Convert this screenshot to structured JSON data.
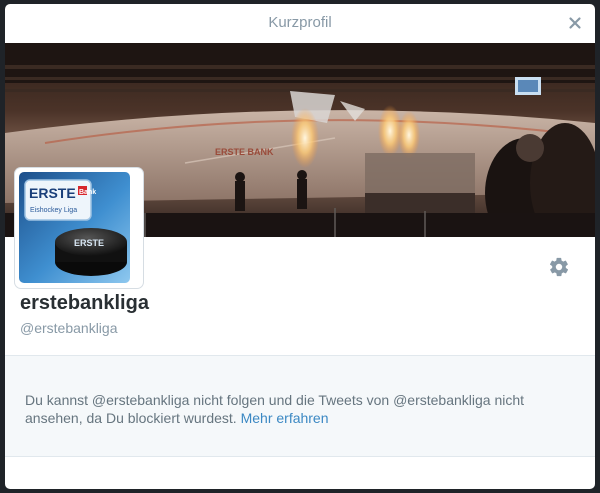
{
  "modal": {
    "title": "Kurzprofil",
    "close_label": "×"
  },
  "profile": {
    "name": "erstebankliga",
    "handle": "@erstebankliga",
    "avatar_logo": {
      "brand": "ERSTE",
      "sub": "Bank",
      "league": "Eishockey Liga",
      "puck_text": "ERSTE"
    }
  },
  "banner": {
    "board_text": "ERSTE BANK"
  },
  "blocked_notice": {
    "text": "Du kannst @erstebankliga nicht folgen und die Tweets von @erstebankliga nicht ansehen, da Du blockiert wurdest.",
    "link": "Mehr erfahren"
  },
  "icons": {
    "close": "close-icon",
    "settings": "gear-icon"
  },
  "colors": {
    "link": "#3b88c3",
    "muted": "#8899a6",
    "name": "#292f33",
    "panel_bg": "#f5f8fa"
  }
}
